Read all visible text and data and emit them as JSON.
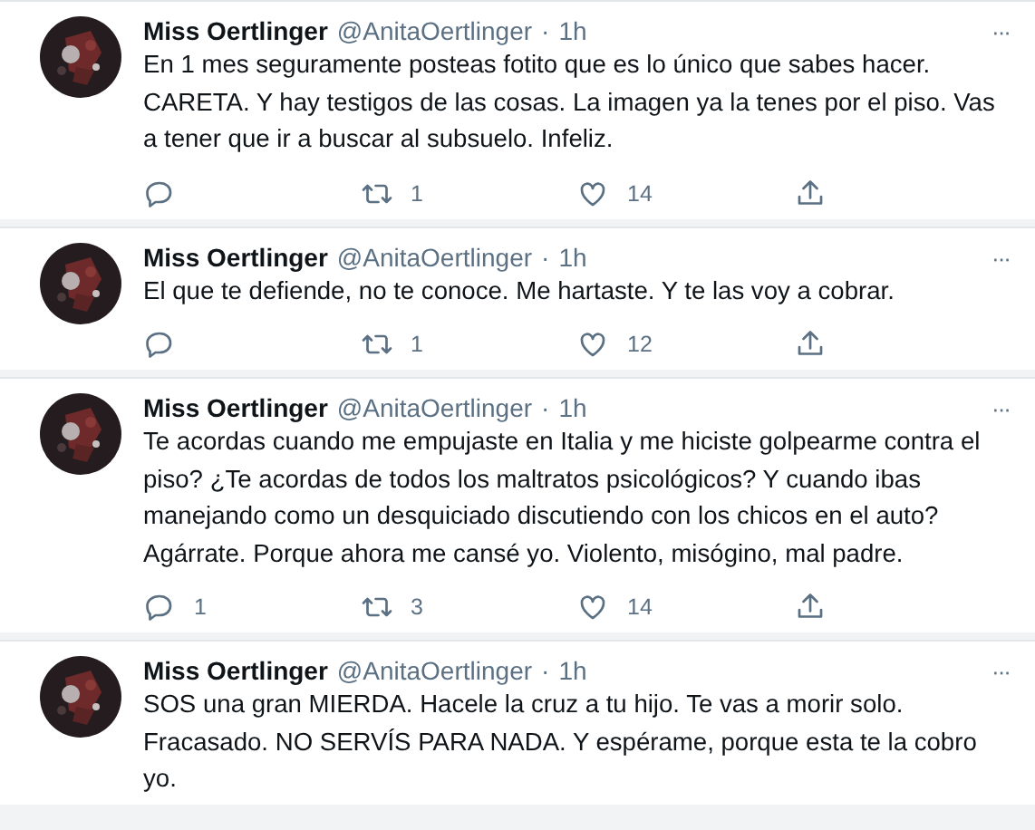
{
  "tweets": [
    {
      "name": "Miss Oertlinger",
      "handle": "@AnitaOertlinger",
      "separator": "·",
      "time": "1h",
      "more": "···",
      "text": "En 1 mes seguramente posteas fotito que es lo único que sabes hacer. CARETA. Y hay testigos de las cosas. La imagen ya la tenes por el piso. Vas a tener que ir a buscar al subsuelo. Infeliz.",
      "actions": {
        "retweets": "1",
        "likes": "14"
      }
    },
    {
      "name": "Miss Oertlinger",
      "handle": "@AnitaOertlinger",
      "separator": "·",
      "time": "1h",
      "more": "···",
      "text": "El que te defiende, no te conoce. Me hartaste. Y te las voy a cobrar.",
      "actions": {
        "retweets": "1",
        "likes": "12"
      }
    },
    {
      "name": "Miss Oertlinger",
      "handle": "@AnitaOertlinger",
      "separator": "·",
      "time": "1h",
      "more": "···",
      "text": "Te acordas cuando me empujaste en Italia y me hiciste golpearme contra el piso? ¿Te acordas de todos los maltratos psicológicos? Y cuando ibas manejando como un desquiciado discutiendo con los chicos en el auto? Agárrate. Porque ahora me cansé yo. Violento, misógino, mal padre.",
      "actions": {
        "replies": "1",
        "retweets": "3",
        "likes": "14"
      }
    },
    {
      "name": "Miss Oertlinger",
      "handle": "@AnitaOertlinger",
      "separator": "·",
      "time": "1h",
      "more": "···",
      "text": "SOS una gran MIERDA. Hacele la cruz a tu hijo. Te vas a morir solo. Fracasado. NO SERVÍS PARA NADA. Y espérame, porque esta te la cobro yo."
    }
  ]
}
